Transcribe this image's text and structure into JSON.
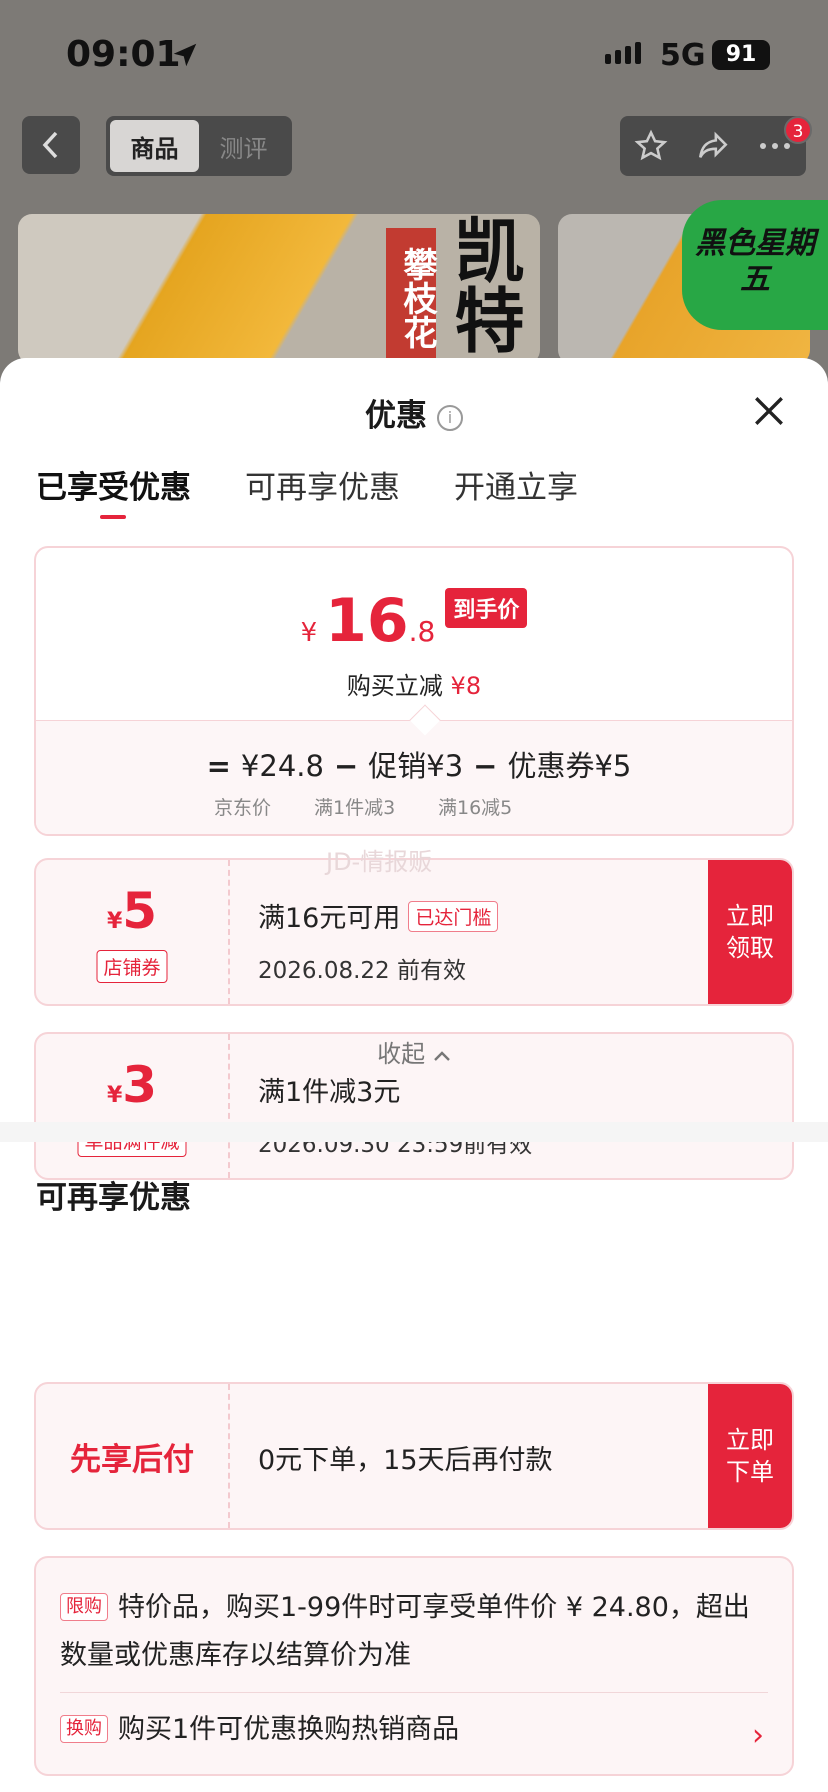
{
  "status": {
    "time": "09:01",
    "network": "5G",
    "battery": "91"
  },
  "nav": {
    "tabs": [
      "商品",
      "测评"
    ],
    "active_tab": "商品",
    "notification_count": "3"
  },
  "banner": {
    "red_vertical": "攀枝花",
    "big_vertical": "凯特",
    "promo": "黑色星期五"
  },
  "sheet": {
    "title": "优惠",
    "tabs": [
      "已享受优惠",
      "可再享优惠",
      "开通立享"
    ],
    "summary": {
      "currency": "¥",
      "price_int": "16",
      "price_dec": ".8",
      "price_tag": "到手价",
      "save_label": "购买立减",
      "save_amount": "¥8",
      "equals": "=",
      "base_price": "¥24.8",
      "minus": "−",
      "promo_item": "促销¥3",
      "coupon_item": "优惠券¥5",
      "base_label": "京东价",
      "promo_label": "满1件减3",
      "coupon_label": "满16减5"
    },
    "watermark": "JD-情报贩",
    "coupons": [
      {
        "currency": "¥",
        "amount": "5",
        "tag": "店铺券",
        "condition": "满16元可用",
        "badge": "已达门槛",
        "expiry": "2026.08.22 前有效",
        "button": "立即领取"
      },
      {
        "currency": "¥",
        "amount": "3",
        "tag": "单品满件减",
        "condition": "满1件减3元",
        "expiry": "2026.09.30 23:59前有效"
      }
    ],
    "collapse_label": "收起",
    "more_title": "可再享优惠",
    "pay_later": {
      "label": "先享后付",
      "desc": "0元下单，15天后再付款",
      "button": "立即下单"
    },
    "rules": [
      {
        "tag": "限购",
        "text": "特价品，购买1-99件时可享受单件价 ¥ 24.80，超出数量或优惠库存以结算价为准"
      },
      {
        "tag": "换购",
        "text": "购买1件可优惠换购热销商品"
      }
    ]
  },
  "colors": {
    "accent": "#e5243b",
    "card_bg": "#fdf5f6",
    "card_border": "#f6d3d7"
  }
}
